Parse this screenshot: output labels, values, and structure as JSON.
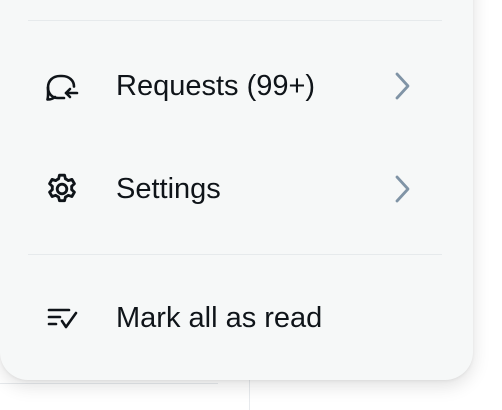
{
  "menu": {
    "items": [
      {
        "label": "Requests (99+)",
        "icon": "message-request-icon",
        "has_submenu": true
      },
      {
        "label": "Settings",
        "icon": "gear-icon",
        "has_submenu": true
      },
      {
        "label": "Mark all as read",
        "icon": "mark-read-icon",
        "has_submenu": false
      }
    ]
  },
  "colors": {
    "menu_background": "#f6f8f8",
    "text": "#0f1419",
    "chevron": "#8094a6",
    "divider": "#e6eaec"
  }
}
